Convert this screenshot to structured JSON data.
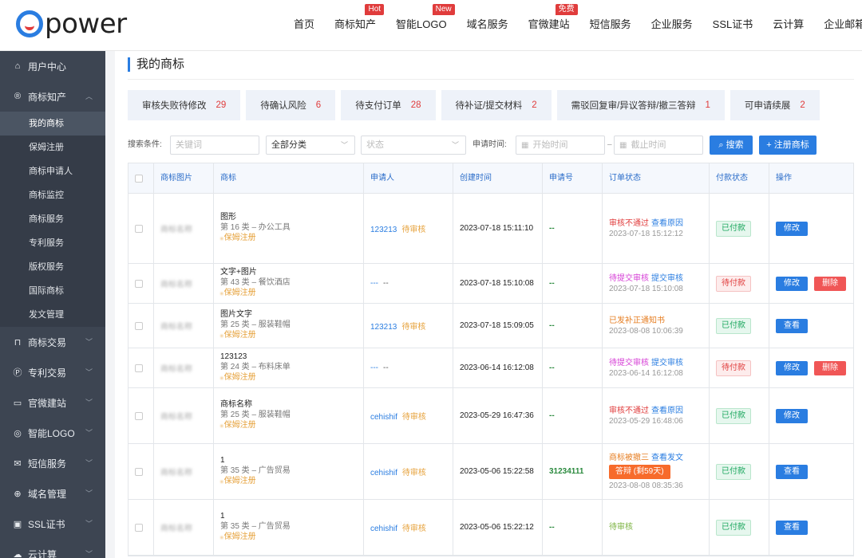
{
  "brand": {
    "logo_text": "power"
  },
  "topnav": [
    {
      "label": "首页",
      "badge": ""
    },
    {
      "label": "商标知产",
      "badge": "Hot"
    },
    {
      "label": "智能LOGO",
      "badge": "New"
    },
    {
      "label": "域名服务",
      "badge": ""
    },
    {
      "label": "官微建站",
      "badge": "免费"
    },
    {
      "label": "短信服务",
      "badge": ""
    },
    {
      "label": "企业服务",
      "badge": ""
    },
    {
      "label": "SSL证书",
      "badge": ""
    },
    {
      "label": "云计算",
      "badge": ""
    },
    {
      "label": "企业邮箱",
      "badge": ""
    }
  ],
  "sidebar": {
    "user_center": "用户中心",
    "ip": "商标知产",
    "sub": [
      "我的商标",
      "保姆注册",
      "商标申请人",
      "商标监控",
      "商标服务",
      "专利服务",
      "版权服务",
      "国际商标",
      "发文管理"
    ],
    "groups": [
      "商标交易",
      "专利交易",
      "官微建站",
      "智能LOGO",
      "短信服务",
      "域名管理",
      "SSL证书",
      "云计算"
    ]
  },
  "page": {
    "title": "我的商标"
  },
  "stats": [
    {
      "label": "审核失败待修改",
      "count": "29"
    },
    {
      "label": "待确认风险",
      "count": "6"
    },
    {
      "label": "待支付订单",
      "count": "28"
    },
    {
      "label": "待补证/提交材料",
      "count": "2"
    },
    {
      "label": "需驳回复审/异议答辩/撤三答辩",
      "count": "1"
    },
    {
      "label": "可申请续展",
      "count": "2"
    }
  ],
  "filter": {
    "label": "搜索条件:",
    "keyword_placeholder": "关键词",
    "category_value": "全部分类",
    "status_placeholder": "状态",
    "date_label": "申请时间:",
    "start_placeholder": "开始时间",
    "sep": "–",
    "end_placeholder": "截止时间",
    "search_label": "搜索",
    "register_label": "注册商标"
  },
  "table": {
    "headers": [
      "商标图片",
      "商标",
      "申请人",
      "创建时间",
      "申请号",
      "订单状态",
      "付款状态",
      "操作"
    ],
    "rows": [
      {
        "img": "商标名称",
        "name": "图形",
        "cls": "第 16 类 – 办公工具",
        "tag": "保姆注册",
        "applicant": "123213",
        "app_status": "待审核",
        "created": "2023-07-18 15:11:10",
        "app_no": "--",
        "status": "审核不通过",
        "status_color": "red",
        "status_link": "查看原因",
        "status_time": "2023-07-18 15:12:12",
        "argue": "",
        "pay": "已付款",
        "pay_type": "paid",
        "ops": [
          {
            "label": "修改",
            "type": "blue"
          }
        ]
      },
      {
        "img": "商标名称",
        "name": "文字+图片",
        "cls": "第 43 类 – 餐饮酒店",
        "tag": "保姆注册",
        "applicant": "---",
        "app_status": "--",
        "created": "2023-07-18 15:10:08",
        "app_no": "--",
        "status": "待提交审核",
        "status_color": "pink",
        "status_link": "提交审核",
        "status_time": "2023-07-18 15:10:08",
        "argue": "",
        "pay": "待付款",
        "pay_type": "unpaid",
        "ops": [
          {
            "label": "修改",
            "type": "blue"
          },
          {
            "label": "删除",
            "type": "red"
          }
        ]
      },
      {
        "img": "商标名称",
        "name": "图片文字",
        "cls": "第 25 类 – 服装鞋帽",
        "tag": "保姆注册",
        "applicant": "123213",
        "app_status": "待审核",
        "created": "2023-07-18 15:09:05",
        "app_no": "--",
        "status": "已发补正通知书",
        "status_color": "orange",
        "status_link": "",
        "status_time": "2023-08-08 10:06:39",
        "argue": "",
        "pay": "已付款",
        "pay_type": "paid",
        "ops": [
          {
            "label": "查看",
            "type": "blue"
          }
        ]
      },
      {
        "img": "商标名称",
        "name": "123123",
        "cls": "第 24 类 – 布料床单",
        "tag": "保姆注册",
        "applicant": "---",
        "app_status": "--",
        "created": "2023-06-14 16:12:08",
        "app_no": "--",
        "status": "待提交审核",
        "status_color": "pink",
        "status_link": "提交审核",
        "status_time": "2023-06-14 16:12:08",
        "argue": "",
        "pay": "待付款",
        "pay_type": "unpaid",
        "ops": [
          {
            "label": "修改",
            "type": "blue"
          },
          {
            "label": "删除",
            "type": "red"
          }
        ]
      },
      {
        "img": "商标名称",
        "name": "商标名称",
        "cls": "第 25 类 – 服装鞋帽",
        "tag": "保姆注册",
        "applicant": "cehishif",
        "app_status": "待审核",
        "created": "2023-05-29 16:47:36",
        "app_no": "--",
        "status": "审核不通过",
        "status_color": "red",
        "status_link": "查看原因",
        "status_time": "2023-05-29 16:48:06",
        "argue": "",
        "pay": "已付款",
        "pay_type": "paid",
        "ops": [
          {
            "label": "修改",
            "type": "blue"
          }
        ]
      },
      {
        "img": "商标名称",
        "name": "1",
        "cls": "第 35 类 – 广告贸易",
        "tag": "保姆注册",
        "applicant": "cehishif",
        "app_status": "待审核",
        "created": "2023-05-06 15:22:58",
        "app_no": "31234111",
        "status": "商标被撤三",
        "status_color": "orange",
        "status_link": "查看发文",
        "status_time": "2023-08-08 08:35:36",
        "argue": "答辩 (剩59天)",
        "pay": "已付款",
        "pay_type": "paid",
        "ops": [
          {
            "label": "查看",
            "type": "blue"
          }
        ]
      },
      {
        "img": "商标名称",
        "name": "1",
        "cls": "第 35 类 – 广告贸易",
        "tag": "保姆注册",
        "applicant": "cehishif",
        "app_status": "待审核",
        "created": "2023-05-06 15:22:12",
        "app_no": "--",
        "status": "待审核",
        "status_color": "green",
        "status_link": "",
        "status_time": "",
        "argue": "",
        "pay": "已付款",
        "pay_type": "paid",
        "ops": [
          {
            "label": "查看",
            "type": "blue"
          }
        ]
      }
    ]
  }
}
